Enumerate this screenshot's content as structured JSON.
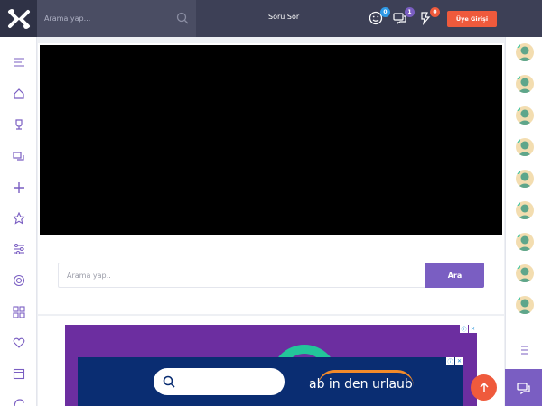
{
  "header": {
    "search_placeholder": "Arama yap...",
    "ask_label": "Soru Sor",
    "notifications_count": "0",
    "messages_count": "1",
    "activity_count": "0",
    "login_label": "Üye Girişi"
  },
  "search": {
    "placeholder": "Arama yap..",
    "button_label": "Ara"
  },
  "ad": {
    "brand_text": "ab in den urlaub"
  },
  "colors": {
    "header_bg": "#3d4056",
    "accent_purple": "#7a5ec2",
    "accent_orange": "#ef5a3c"
  },
  "icons": {
    "left_sidebar": [
      "menu-icon",
      "home-icon",
      "trophy-icon",
      "chat-icon",
      "plus-icon",
      "star-icon",
      "sliders-icon",
      "target-icon",
      "grid-icon",
      "heart-icon",
      "calendar-icon",
      "swirl-icon"
    ]
  }
}
